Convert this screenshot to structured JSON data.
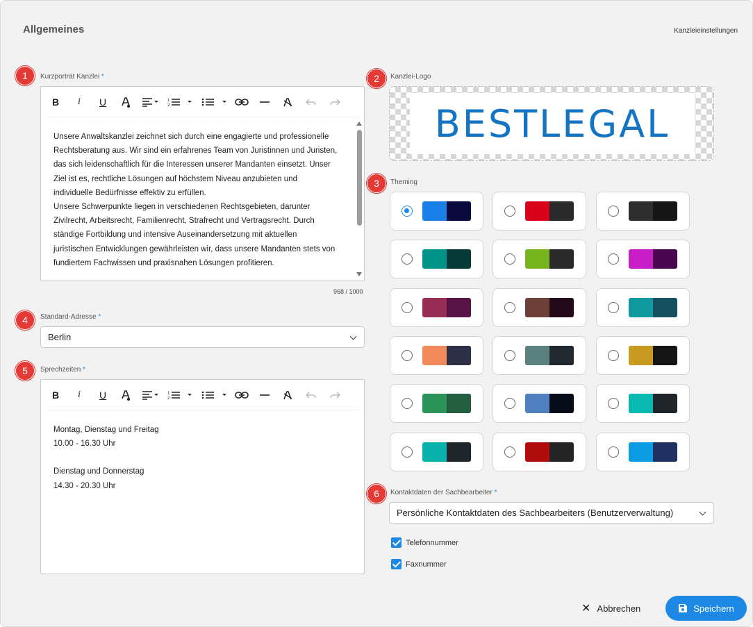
{
  "header": {
    "title": "Allgemeines",
    "breadcrumb": "Kanzleieinstellungen"
  },
  "markers": [
    "1",
    "2",
    "3",
    "4",
    "5",
    "6"
  ],
  "portrait": {
    "label": "Kurzporträt Kanzlei",
    "required": "*",
    "paragraphs": [
      "Unsere Anwaltskanzlei zeichnet sich durch eine engagierte und professionelle Rechtsberatung aus. Wir sind ein erfahrenes Team von Juristinnen und Juristen, das sich leidenschaftlich für die Interessen unserer Mandanten einsetzt. Unser Ziel ist es, rechtliche Lösungen auf höchstem Niveau anzubieten und individuelle Bedürfnisse effektiv zu erfüllen.",
      "Unsere Schwerpunkte liegen in verschiedenen Rechtsgebieten, darunter Zivilrecht, Arbeitsrecht, Familienrecht, Strafrecht und Vertragsrecht. Durch ständige Fortbildung und intensive Auseinandersetzung mit aktuellen juristischen Entwicklungen gewährleisten wir, dass unsere Mandanten stets von fundiertem Fachwissen und praxisnahen Lösungen profitieren."
    ],
    "counter": "968 / 1000"
  },
  "toolbar": {
    "bold": "B",
    "italic": "i",
    "underline": "U",
    "color": "A",
    "align": "≡",
    "ol": "≔",
    "ul": "☰",
    "link": "⛓",
    "hr": "—",
    "clear": "A",
    "undo": "↶",
    "redo": "↷"
  },
  "address": {
    "label": "Standard-Adresse",
    "required": "*",
    "value": "Berlin"
  },
  "hours": {
    "label": "Sprechzeiten",
    "required": "*",
    "lines": [
      "Montag, Dienstag und Freitag",
      "10.00 - 16.30 Uhr",
      "",
      "Dienstag und Donnerstag",
      "14.30 - 20.30 Uhr"
    ]
  },
  "logo": {
    "label": "Kanzlei-Logo",
    "text": "BESTLEGAL"
  },
  "theming": {
    "label": "Theming",
    "selected_index": 0,
    "themes": [
      [
        "#1a7fe6",
        "#0b0a3e"
      ],
      [
        "#d9001b",
        "#2a2a2a"
      ],
      [
        "#2e2e2e",
        "#151515"
      ],
      [
        "#00938a",
        "#063a36"
      ],
      [
        "#78b41e",
        "#2a2a2a"
      ],
      [
        "#c81ec8",
        "#4a0550"
      ],
      [
        "#982d55",
        "#561544"
      ],
      [
        "#6c3f38",
        "#250a1a"
      ],
      [
        "#0f9aa0",
        "#145060"
      ],
      [
        "#f08a5a",
        "#2e3145"
      ],
      [
        "#5a8080",
        "#22292e"
      ],
      [
        "#c99a22",
        "#151515"
      ],
      [
        "#2a945a",
        "#235e3e"
      ],
      [
        "#4f7fbd",
        "#060c18"
      ],
      [
        "#08b9b0",
        "#1f2528"
      ],
      [
        "#08b2aa",
        "#1f2528"
      ],
      [
        "#b00c0c",
        "#242424"
      ],
      [
        "#0b9be3",
        "#203060"
      ]
    ]
  },
  "contact": {
    "label": "Kontaktdaten der Sachbearbeiter",
    "required": "*",
    "value": "Persönliche Kontaktdaten des Sachbearbeiters (Benutzerverwaltung)",
    "checkboxes": [
      {
        "label": "Telefonnummer",
        "checked": true
      },
      {
        "label": "Faxnummer",
        "checked": true
      }
    ]
  },
  "footer": {
    "cancel": "Abbrechen",
    "save": "Speichern"
  }
}
